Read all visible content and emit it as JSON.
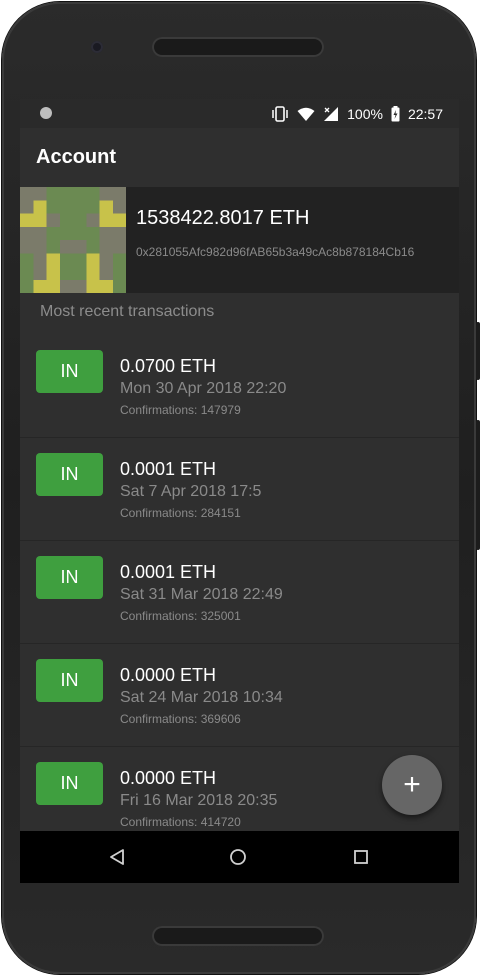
{
  "status_bar": {
    "battery": "100%",
    "time": "22:57"
  },
  "app_bar": {
    "title": "Account"
  },
  "account": {
    "balance": "1538422.8017 ETH",
    "address": "0x281055Afc982d96fAB65b3a49cAc8b878184Cb16",
    "avatar_icon": "identicon"
  },
  "section_title": "Most recent transactions",
  "transactions": [
    {
      "direction": "IN",
      "amount": "0.0700 ETH",
      "date": "Mon 30 Apr 2018 22:20",
      "confirmations": "Confirmations: 147979"
    },
    {
      "direction": "IN",
      "amount": "0.0001 ETH",
      "date": "Sat 7 Apr 2018 17:5",
      "confirmations": "Confirmations: 284151"
    },
    {
      "direction": "IN",
      "amount": "0.0001 ETH",
      "date": "Sat 31 Mar 2018 22:49",
      "confirmations": "Confirmations: 325001"
    },
    {
      "direction": "IN",
      "amount": "0.0000 ETH",
      "date": "Sat 24 Mar 2018 10:34",
      "confirmations": "Confirmations: 369606"
    },
    {
      "direction": "IN",
      "amount": "0.0000 ETH",
      "date": "Fri 16 Mar 2018 20:35",
      "confirmations": "Confirmations: 414720"
    }
  ],
  "fab": {
    "label": "+"
  },
  "colors": {
    "in_badge": "#3f9f3f",
    "background": "#2f2f2f",
    "card": "#222222",
    "fab": "#666666"
  }
}
